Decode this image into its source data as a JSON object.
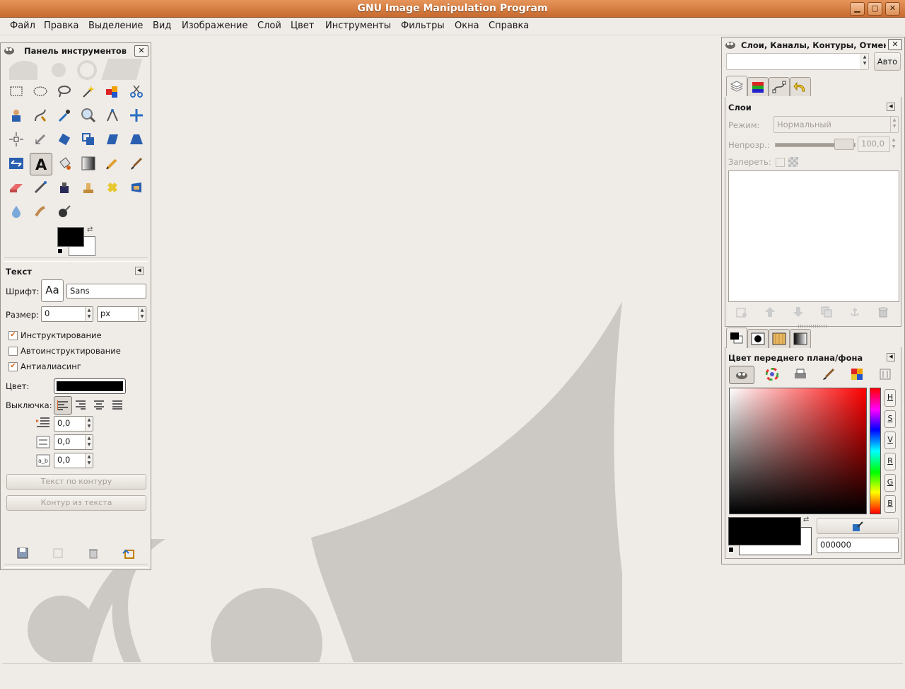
{
  "window": {
    "title": "GNU Image Manipulation Program",
    "btn_min": "▁",
    "btn_max": "▢",
    "btn_close": "✕"
  },
  "menu": [
    "Файл",
    "Правка",
    "Выделение",
    "Вид",
    "Изображение",
    "Слой",
    "Цвет",
    "Инструменты",
    "Фильтры",
    "Окна",
    "Справка"
  ],
  "toolbox": {
    "title": "Панель инструментов",
    "close": "✕",
    "tools": [
      "rect-select",
      "ellipse-select",
      "free-select",
      "fuzzy-select",
      "select-by-color",
      "scissors",
      "foreground-select",
      "paths",
      "color-picker",
      "zoom",
      "measure",
      "move",
      "align",
      "crop",
      "rotate",
      "scale",
      "shear",
      "perspective",
      "flip",
      "text",
      "bucket-fill",
      "blend",
      "pencil",
      "paintbrush",
      "eraser",
      "airbrush",
      "ink",
      "clone",
      "heal",
      "perspective-clone",
      "blur",
      "smudge",
      "dodge-burn"
    ],
    "active_tool": "text",
    "fg_color": "#000000",
    "bg_color": "#ffffff"
  },
  "text_options": {
    "title": "Текст",
    "font_label": "Шрифт:",
    "font_preview": "Aa",
    "font_value": "Sans",
    "size_label": "Размер:",
    "size_value": "0",
    "size_unit": "px",
    "hinting_label": "Инструктирование",
    "hinting_checked": true,
    "autohint_label": "Автоинструктирование",
    "autohint_checked": false,
    "antialias_label": "Антиалиасинг",
    "antialias_checked": true,
    "color_label": "Цвет:",
    "color_value": "#000000",
    "justify_label": "Выключка:",
    "indent_value": "0,0",
    "line_spacing_value": "0,0",
    "letter_spacing_value": "0,0",
    "text_along_path": "Текст по контуру",
    "path_from_text": "Контур из текста"
  },
  "layers_dock": {
    "title": "Слои, Каналы, Контуры, Отмен",
    "close": "✕",
    "image_select_value": "",
    "auto_button": "Авто",
    "panel_title": "Слои",
    "mode_label": "Режим:",
    "mode_value": "Нормальный",
    "opacity_label": "Непрозр.:",
    "opacity_value": "100,0",
    "opacity_percent": 100,
    "lock_label": "Запереть:"
  },
  "color_dock": {
    "title": "Цвет переднего плана/фона",
    "channels": [
      "H",
      "S",
      "V",
      "R",
      "G",
      "B"
    ],
    "hex_value": "000000",
    "fg_color": "#000000",
    "bg_color": "#ffffff"
  },
  "colors": {
    "title_orange": "#d9834a",
    "check_orange": "#d0621a",
    "wilber_gray": "#ccc8c4"
  }
}
